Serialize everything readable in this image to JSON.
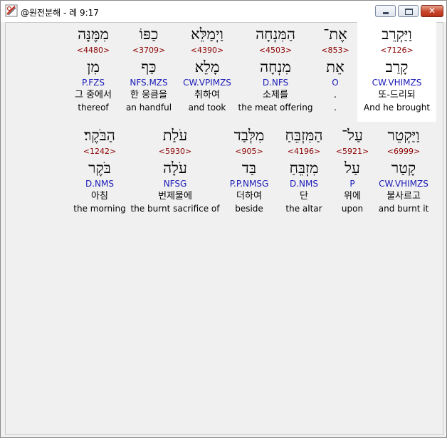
{
  "window": {
    "title": "@원전분해 - 레 9:17",
    "minimize_icon": "minimize-icon",
    "maximize_icon": "maximize-icon",
    "close_glyph": "✕"
  },
  "row1": [
    {
      "hebrew": "וַיַּקְרֵב",
      "strong": "<7126>",
      "lemma": "קָרַב",
      "parse": "CW.VHIMZS",
      "korean": "또-드리되",
      "english": "And he brought",
      "selected": true
    },
    {
      "hebrew": "אֶת־",
      "strong": "<853>",
      "lemma": "אֵת",
      "parse": "O",
      "korean": ".",
      "english": "."
    },
    {
      "hebrew": "הַמִּנְחָה",
      "strong": "<4503>",
      "lemma": "מִנְחָה",
      "parse": "D.NFS",
      "korean": "소제를",
      "english": "the meat offering"
    },
    {
      "hebrew": "וַיְמַלֵּא",
      "strong": "<4390>",
      "lemma": "מָלֵא",
      "parse": "CW.VPIMZS",
      "korean": "취하여",
      "english": "and took"
    },
    {
      "hebrew": "כַפּוֹ",
      "strong": "<3709>",
      "lemma": "כַּף",
      "parse": "NFS.MZS",
      "korean": "한 웅큼을",
      "english": "an handful"
    },
    {
      "hebrew": "מִמֶּנָּה",
      "strong": "<4480>",
      "lemma": "מִן",
      "parse": "P.FZS",
      "korean": "그 중에서",
      "english": "thereof"
    }
  ],
  "row2": [
    {
      "hebrew": "וַיַּקְטֵר",
      "strong": "<6999>",
      "lemma": "קָטַר",
      "parse": "CW.VHIMZS",
      "korean": "불사르고",
      "english": "and burnt it"
    },
    {
      "hebrew": "עַל־",
      "strong": "<5921>",
      "lemma": "עַל",
      "parse": "P",
      "korean": "위에",
      "english": "upon"
    },
    {
      "hebrew": "הַמִּזְבֵּחַ",
      "strong": "<4196>",
      "lemma": "מִזְבֵּחַ",
      "parse": "D.NMS",
      "korean": "단",
      "english": "the altar"
    },
    {
      "hebrew": "מִלְּבַד",
      "strong": "<905>",
      "lemma": "בַּד",
      "parse": "P.P.NMSG",
      "korean": "더하여",
      "english": "beside"
    },
    {
      "hebrew": "עֹלַת",
      "strong": "<5930>",
      "lemma": "עֹלָה",
      "parse": "NFSG",
      "korean": "번제물에",
      "english": "the burnt sacrifice of"
    },
    {
      "hebrew": "הַבֹּקֶר׃",
      "strong": "<1242>",
      "lemma": "בֹּקֶר",
      "parse": "D.NMS",
      "korean": "아침",
      "english": "the morning"
    }
  ]
}
